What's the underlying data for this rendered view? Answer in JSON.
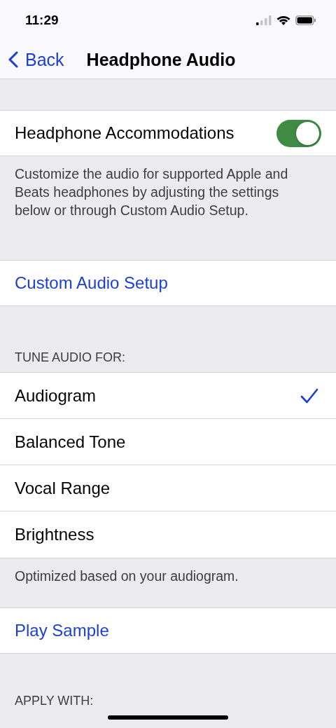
{
  "status_bar": {
    "time": "11:29"
  },
  "nav": {
    "back": "Back",
    "title": "Headphone Audio"
  },
  "accommodations": {
    "label": "Headphone Accommodations",
    "on": true,
    "description": "Customize the audio for supported Apple and Beats headphones by adjusting the settings below or through Custom Audio Setup."
  },
  "custom_setup": {
    "label": "Custom Audio Setup"
  },
  "tune": {
    "header": "TUNE AUDIO FOR:",
    "options": [
      {
        "label": "Audiogram",
        "selected": true
      },
      {
        "label": "Balanced Tone",
        "selected": false
      },
      {
        "label": "Vocal Range",
        "selected": false
      },
      {
        "label": "Brightness",
        "selected": false
      }
    ],
    "footer": "Optimized based on your audiogram."
  },
  "play_sample": {
    "label": "Play Sample"
  },
  "apply": {
    "header": "APPLY WITH:"
  }
}
